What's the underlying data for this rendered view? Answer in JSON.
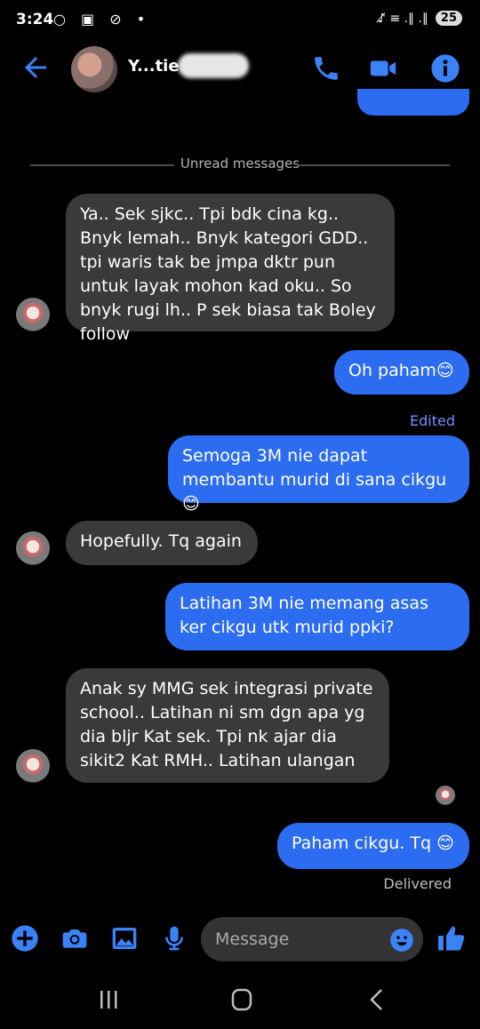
{
  "status": {
    "time": "3:24",
    "left_icons": "○ ▣ ⊘ •",
    "right_icons": "♪̸ ≡ .∥ .∥",
    "battery": "25"
  },
  "header": {
    "contact_name": "Y...tie Yatt"
  },
  "divider": {
    "label": "Unread messages"
  },
  "messages": [
    {
      "dir": "in",
      "text": "Ya.. Sek sjkc.. Tpi bdk cina kg.. Bnyk lemah.. Bnyk kategori GDD.. tpi waris tak be jmpa dktr pun untuk layak mohon kad oku.. So bnyk rugi lh.. P sek biasa tak Boley follow"
    },
    {
      "dir": "out",
      "text": "Oh paham😊"
    },
    {
      "dir": "out",
      "text": "Semoga 3M nie dapat membantu murid di sana cikgu 😊"
    },
    {
      "dir": "in",
      "text": "Hopefully. Tq again"
    },
    {
      "dir": "out",
      "text": "Latihan 3M nie memang asas ker cikgu utk murid ppki?"
    },
    {
      "dir": "in",
      "text": "Anak sy MMG sek integrasi private school.. Latihan ni sm dgn apa yg dia bljr Kat sek. Tpi nk ajar dia sikit2 Kat RMH.. Latihan ulangan"
    },
    {
      "dir": "out",
      "text": "Paham cikgu. Tq 😊"
    }
  ],
  "labels": {
    "edited": "Edited",
    "delivered": "Delivered"
  },
  "composer": {
    "placeholder": "Message"
  },
  "colors": {
    "accent": "#2b6cf0",
    "incoming_bubble": "#3a3a3c",
    "background": "#000000"
  }
}
